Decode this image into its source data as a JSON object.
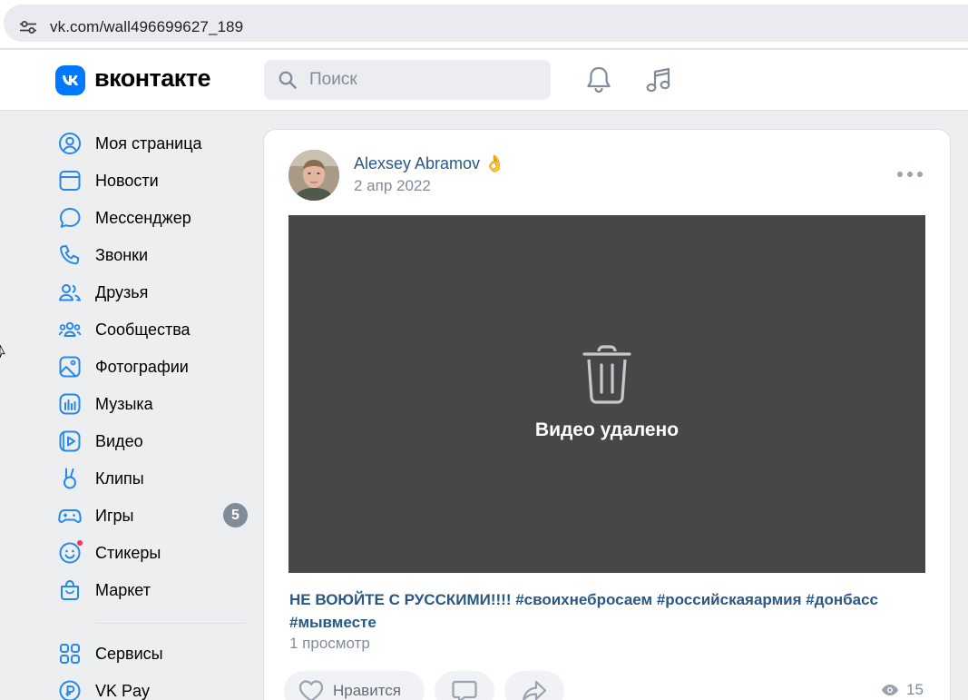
{
  "browser": {
    "url": "vk.com/wall496699627_189",
    "site_settings_icon": "tune-icon"
  },
  "header": {
    "logo_text": "вконтакте",
    "search_placeholder": "Поиск",
    "brand_color": "#0077ff"
  },
  "sidebar": {
    "items": [
      {
        "label": "Моя страница",
        "icon": "user-circle-icon"
      },
      {
        "label": "Новости",
        "icon": "newsfeed-icon"
      },
      {
        "label": "Мессенджер",
        "icon": "message-icon"
      },
      {
        "label": "Звонки",
        "icon": "phone-icon"
      },
      {
        "label": "Друзья",
        "icon": "friends-icon"
      },
      {
        "label": "Сообщества",
        "icon": "communities-icon"
      },
      {
        "label": "Фотографии",
        "icon": "photo-icon"
      },
      {
        "label": "Музыка",
        "icon": "music-icon"
      },
      {
        "label": "Видео",
        "icon": "video-icon"
      },
      {
        "label": "Клипы",
        "icon": "clips-icon"
      },
      {
        "label": "Игры",
        "icon": "gamepad-icon",
        "badge": "5"
      },
      {
        "label": "Стикеры",
        "icon": "sticker-icon"
      },
      {
        "label": "Маркет",
        "icon": "market-bag-icon"
      },
      {
        "label": "Сервисы",
        "icon": "services-grid-icon"
      },
      {
        "label": "VK Pay",
        "icon": "vk-pay-icon"
      }
    ]
  },
  "post": {
    "author": "Alexsey Abramov 👌",
    "date": "2 апр 2022",
    "video_message": "Видео удалено",
    "text": "НЕ ВОЮЙТЕ С РУССКИМИ!!!! #своихнебросаем #российскаяармия #донбасс #мывместе",
    "views_text": "1 просмотр",
    "like_label": "Нравится",
    "views_count": "15"
  }
}
